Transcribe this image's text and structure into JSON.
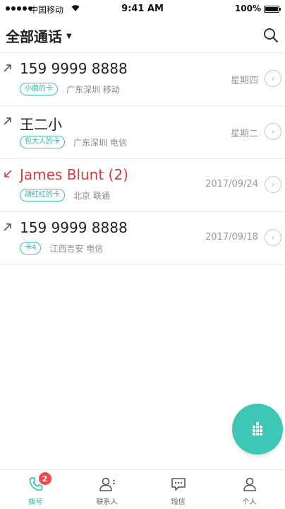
{
  "status_bar": {
    "carrier": "中国移动",
    "time": "9:41 AM",
    "battery": "100%"
  },
  "header": {
    "title": "全部通话"
  },
  "calls": [
    {
      "name": "159 9999 8888",
      "sim": "小茵的卡",
      "location": "广东深圳 移动",
      "time": "星期四",
      "direction": "outgoing",
      "missed": false
    },
    {
      "name": "王二小",
      "sim": "包大人的卡",
      "location": "广东深圳 电信",
      "time": "星期二",
      "direction": "outgoing",
      "missed": false
    },
    {
      "name": "James Blunt (2)",
      "sim": "胡红红的卡",
      "location": "北京 联通",
      "time": "2017/09/24",
      "direction": "incoming",
      "missed": true
    },
    {
      "name": "159 9999 8888",
      "sim": "卡4",
      "location": "江西吉安 电信",
      "time": "2017/09/18",
      "direction": "outgoing",
      "missed": false
    }
  ],
  "tabs": [
    {
      "label": "拨号",
      "icon": "phone-icon",
      "badge": "2",
      "active": true
    },
    {
      "label": "联系人",
      "icon": "contacts-icon",
      "active": false
    },
    {
      "label": "短信",
      "icon": "message-icon",
      "active": false
    },
    {
      "label": "个人",
      "icon": "person-icon",
      "active": false
    }
  ],
  "colors": {
    "accent": "#3cc8b4",
    "missed": "#e0393e",
    "badge": "#f2494b"
  }
}
